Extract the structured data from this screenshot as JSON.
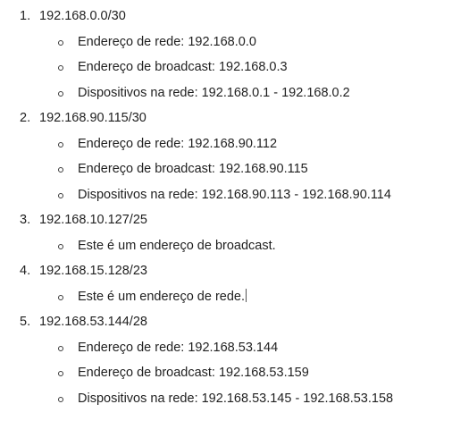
{
  "document": {
    "entries": [
      {
        "number": "1.",
        "network": "192.168.0.0/30",
        "details": [
          "Endereço de rede: 192.168.0.0",
          "Endereço de broadcast: 192.168.0.3",
          "Dispositivos na rede: 192.168.0.1 - 192.168.0.2"
        ]
      },
      {
        "number": "2.",
        "network": "192.168.90.115/30",
        "details": [
          "Endereço de rede: 192.168.90.112",
          "Endereço de broadcast: 192.168.90.115",
          "Dispositivos na rede: 192.168.90.113 - 192.168.90.114"
        ]
      },
      {
        "number": "3.",
        "network": "192.168.10.127/25",
        "details": [
          "Este é um endereço de broadcast."
        ]
      },
      {
        "number": "4.",
        "network": "192.168.15.128/23",
        "details": [
          "Este é um endereço de rede."
        ]
      },
      {
        "number": "5.",
        "network": "192.168.53.144/28",
        "details": [
          "Endereço de rede: 192.168.53.144",
          "Endereço de broadcast: 192.168.53.159",
          "Dispositivos na rede: 192.168.53.145 - 192.168.53.158"
        ]
      }
    ]
  }
}
